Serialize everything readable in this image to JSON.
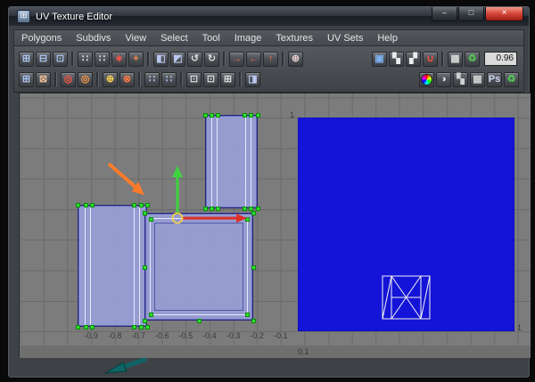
{
  "window": {
    "title": "UV Texture Editor",
    "icon_glyph": "⊞",
    "min_glyph": "–",
    "max_glyph": "□",
    "close_glyph": "×"
  },
  "menubar": {
    "items": [
      "Polygons",
      "Subdivs",
      "View",
      "Select",
      "Tool",
      "Image",
      "Textures",
      "UV Sets",
      "Help"
    ]
  },
  "toolbar": {
    "value": "0.96",
    "row1": [
      {
        "name": "grid-texture-icon",
        "glyph": "⊞",
        "color": "#a9c2ec"
      },
      {
        "name": "grid-shaded-icon",
        "glyph": "⊟",
        "color": "#a9c2ec"
      },
      {
        "name": "grid-distortion-icon",
        "glyph": "⊡",
        "color": "#a9c2ec"
      },
      {
        "sep": true
      },
      {
        "name": "move-uv-left-icon",
        "glyph": "∷",
        "color": "#dde1e8"
      },
      {
        "name": "move-uv-right-icon",
        "glyph": "∷",
        "color": "#dde1e8"
      },
      {
        "name": "cut-uv-edges-icon",
        "glyph": "∗",
        "color": "#ff5645"
      },
      {
        "name": "sew-uv-edges-icon",
        "glyph": "+",
        "color": "#ff8a45"
      },
      {
        "sep": true
      },
      {
        "name": "flip-u-icon",
        "glyph": "◧",
        "color": "#b9c6ee"
      },
      {
        "name": "flip-v-icon",
        "glyph": "◩",
        "color": "#b9c6ee"
      },
      {
        "name": "rotate-ccw-icon",
        "glyph": "↺",
        "color": "#d8d8d8"
      },
      {
        "name": "rotate-cw-icon",
        "glyph": "↻",
        "color": "#d8d8d8"
      },
      {
        "sep": true
      },
      {
        "name": "align-u-min-icon",
        "glyph": "→",
        "color": "#ef6a52"
      },
      {
        "name": "align-u-max-icon",
        "glyph": "←",
        "color": "#ef6a52"
      },
      {
        "name": "align-v-max-icon",
        "glyph": "↑",
        "color": "#ef6a52"
      },
      {
        "sep": true
      },
      {
        "name": "snap-together-icon",
        "glyph": "⊛",
        "color": "#e8cfcf"
      },
      {
        "spacer": true
      },
      {
        "name": "display-image-icon",
        "glyph": "▣",
        "color": "#7fb2f2"
      },
      {
        "name": "checker-display-icon",
        "glyph": "▚",
        "color": "#ececec"
      },
      {
        "name": "filter-display-icon",
        "glyph": "▞",
        "color": "#ececec"
      },
      {
        "name": "magnet-snap-icon",
        "glyph": "∪",
        "color": "#ff4b38"
      },
      {
        "sep": true
      },
      {
        "name": "texture-tile-icon",
        "glyph": "▦",
        "color": "#d6d6d6"
      },
      {
        "name": "update-image-icon",
        "glyph": "♻",
        "color": "#54c454"
      },
      {
        "field": true,
        "name": "dim-value-field"
      }
    ],
    "row2": [
      {
        "name": "uv-lattice-icon",
        "glyph": "⊞",
        "color": "#a9c2ec"
      },
      {
        "name": "uv-smear-icon",
        "glyph": "⊠",
        "color": "#e8b894"
      },
      {
        "sep": true
      },
      {
        "name": "delete-uvs-icon",
        "glyph": "◎",
        "color": "#ff5645"
      },
      {
        "name": "reset-uvs-icon",
        "glyph": "◎",
        "color": "#ff9a45"
      },
      {
        "sep": true
      },
      {
        "name": "weld-uvs-icon",
        "glyph": "⊕",
        "color": "#ffd24e"
      },
      {
        "name": "unweld-uvs-icon",
        "glyph": "⊗",
        "color": "#ff7a45"
      },
      {
        "sep": true
      },
      {
        "name": "snap-uv-grid-icon",
        "glyph": "∷",
        "color": "#a9c2ec"
      },
      {
        "name": "snap-uv-pixel-icon",
        "glyph": "∷",
        "color": "#a9c2ec"
      },
      {
        "sep": true
      },
      {
        "name": "layout-uvs-icon",
        "glyph": "⊡",
        "color": "#d8d8d8"
      },
      {
        "name": "unfold-uvs-icon",
        "glyph": "⊡",
        "color": "#d8d8d8"
      },
      {
        "name": "relax-uvs-icon",
        "glyph": "⊞",
        "color": "#d8d8d8"
      },
      {
        "sep": true
      },
      {
        "name": "isolate-select-icon",
        "glyph": "◨",
        "color": "#b9c6ee"
      },
      {
        "spacer": true
      },
      {
        "wheel": true,
        "name": "rgb-channels-icon"
      },
      {
        "name": "alpha-channel-icon",
        "glyph": "◑",
        "color": "#ececec"
      },
      {
        "name": "dim-image-icon",
        "glyph": "▚",
        "color": "#cfcfcf"
      },
      {
        "name": "pixel-grid-icon",
        "glyph": "▦",
        "color": "#cfcfcf"
      },
      {
        "name": "psd-network-icon",
        "glyph": "Ps",
        "color": "#cfd9f2"
      },
      {
        "name": "force-refresh-icon",
        "glyph": "♻",
        "color": "#54c454"
      }
    ]
  },
  "canvas": {
    "axis_x": [
      "-0.9",
      "-0.8",
      "-0.7",
      "-0.6",
      "-0.5",
      "-0.4",
      "-0.3",
      "-0.2",
      "-0.1"
    ],
    "v_top_label": "1",
    "u_right_label": "1",
    "sub_label": "0.1"
  },
  "colors": {
    "uv_space_blue": "#1414d8",
    "shell_fill": "#989ed6",
    "shell_edge": "#24247c",
    "vertex_green": "#2fe22f",
    "manip_red": "#df2f26",
    "manip_green": "#3fd23f",
    "manip_ring": "#efcf4e",
    "annotation_orange": "#ff7b28",
    "annotation_teal": "#0e6464"
  }
}
